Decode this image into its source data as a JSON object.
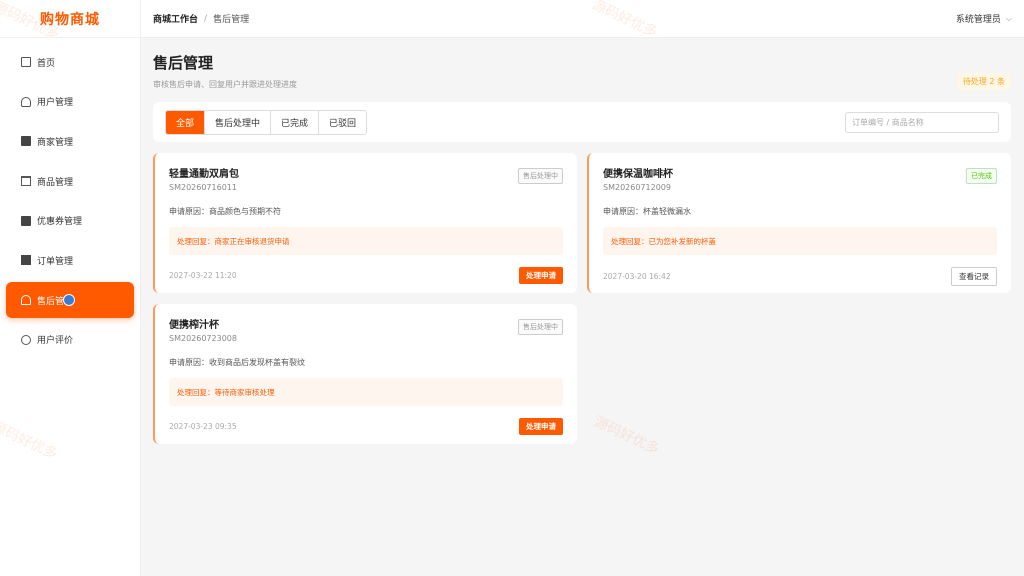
{
  "app": {
    "logo": "购物商城"
  },
  "sidebar": {
    "items": [
      {
        "label": "首页",
        "icon": "monitor-icon"
      },
      {
        "label": "用户管理",
        "icon": "user-icon"
      },
      {
        "label": "商家管理",
        "icon": "shop-icon"
      },
      {
        "label": "商品管理",
        "icon": "bag-icon"
      },
      {
        "label": "优惠券管理",
        "icon": "coupon-icon"
      },
      {
        "label": "订单管理",
        "icon": "clipboard-icon"
      },
      {
        "label": "售后管理",
        "icon": "headset-icon",
        "active": true
      },
      {
        "label": "用户评价",
        "icon": "comment-icon"
      }
    ]
  },
  "topbar": {
    "breadcrumb_root": "商城工作台",
    "breadcrumb_sep": "/",
    "breadcrumb_current": "售后管理",
    "user": "系统管理员",
    "user_chevron": "⌵"
  },
  "page": {
    "title": "售后管理",
    "subtitle": "审核售后申请、回复用户并跟进处理进度",
    "pending_badge": "待处理 2 条"
  },
  "filters": {
    "tabs": [
      "全部",
      "售后处理中",
      "已完成",
      "已驳回"
    ],
    "active_tab": 0,
    "search_placeholder": "订单编号 / 商品名称"
  },
  "cards": [
    {
      "title": "轻量通勤双肩包",
      "order_id": "SM20260716011",
      "status": "售后处理中",
      "reason": "申请原因：商品颜色与预期不符",
      "reply": "处理回复：商家正在审核退货申请",
      "time": "2027-03-22 11:20",
      "action": "处理申请"
    },
    {
      "title": "便携保温咖啡杯",
      "order_id": "SM20260712009",
      "status": "已完成",
      "reason": "申请原因：杯盖轻微漏水",
      "reply": "处理回复：已为您补发新的杯盖",
      "time": "2027-03-20 16:42",
      "action": "查看记录"
    },
    {
      "title": "便携榨汁杯",
      "order_id": "SM20260723008",
      "status": "售后处理中",
      "reason": "申请原因：收到商品后发现杯盖有裂纹",
      "reply": "处理回复：等待商家审核处理",
      "time": "2027-03-23 09:35",
      "action": "处理申请"
    }
  ],
  "watermark": "源码好优多",
  "colors": {
    "accent": "#ff5a00",
    "done": "#52c41a"
  }
}
